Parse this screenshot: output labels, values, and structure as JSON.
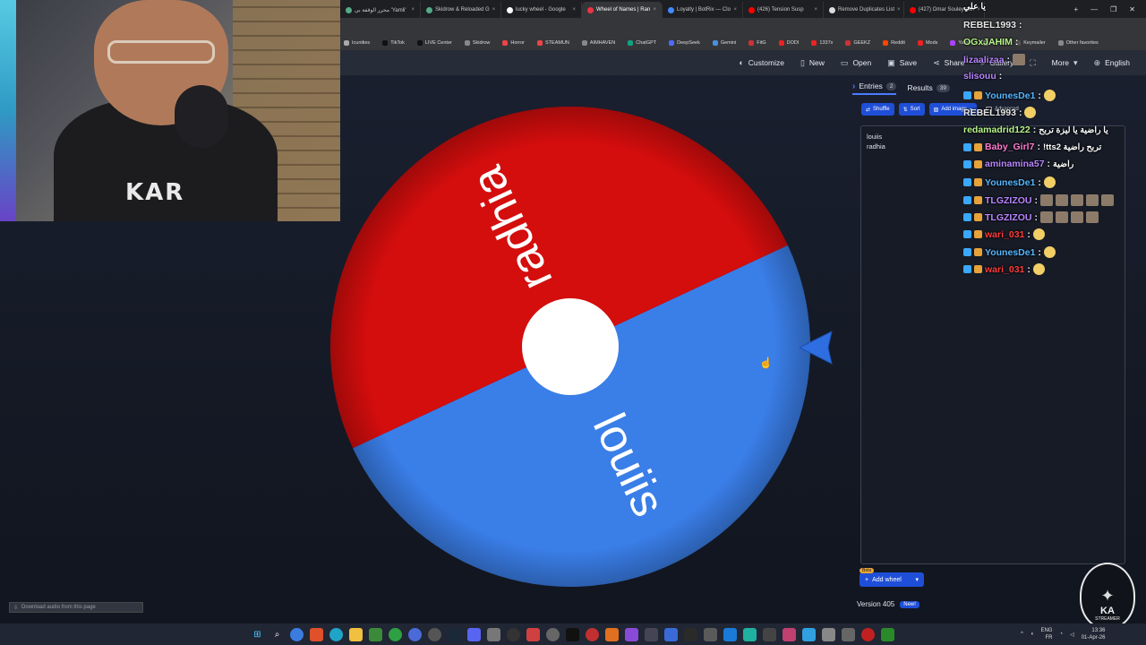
{
  "browser": {
    "tabs": [
      {
        "label": "محرر الوقفة بي 'Yamli'"
      },
      {
        "label": "Skidrow & Reloaded G"
      },
      {
        "label": "lucky wheel - Google"
      },
      {
        "label": "Wheel of Names | Ran"
      },
      {
        "label": "Loyalty | BotRix — Clo"
      },
      {
        "label": "(426) Tension Susp"
      },
      {
        "label": "Remove Duplicates List"
      },
      {
        "label": "(427) Omar Souleyman"
      }
    ],
    "bookmarks": [
      "Icunities",
      "TikTok",
      "LIVE Center",
      "Skidrow",
      "Horror",
      "STEAMUN",
      "AIMHAVEN",
      "ChatGPT",
      "DeepSeek",
      "Gemini",
      "FitG",
      "DODI",
      "1337x",
      "GEEKZ",
      "Reddit",
      "Mods",
      "Yamli",
      "Lurkit",
      "Keymailer",
      "Other favorites"
    ]
  },
  "toolbar": {
    "customize": "Customize",
    "new": "New",
    "open": "Open",
    "save": "Save",
    "share": "Share",
    "gallery": "Gallery",
    "more": "More",
    "language": "English"
  },
  "webcam": {
    "shirt_text": "KAR"
  },
  "chart_data": {
    "type": "pie",
    "categories": [
      "louiis",
      "radhia"
    ],
    "values": [
      50,
      50
    ],
    "colors": [
      "#3a7ee8",
      "#d40d0d"
    ],
    "rotation_deg": -25
  },
  "panel": {
    "tabs": {
      "entries": "Entries",
      "entries_count": "2",
      "results": "Results",
      "results_count": "39"
    },
    "buttons": {
      "shuffle": "Shuffle",
      "sort": "Sort",
      "add_image": "Add image",
      "advanced": "Advanced"
    },
    "entries": [
      "louiis",
      "radhia"
    ],
    "beta": "Beta",
    "add_wheel": "Add wheel",
    "version": "Version 405",
    "new_badge": "New!"
  },
  "chat": [
    {
      "user": "",
      "text": "يا علي",
      "user_color": "#ffffff"
    },
    {
      "user": "REBEL1993",
      "text": "",
      "user_color": "#e8e8e8"
    },
    {
      "user": "OGxJAHIM",
      "text": "",
      "user_color": "#b6f58a"
    },
    {
      "user": "lizaalizaa",
      "text": "",
      "user_color": "#b985ff"
    },
    {
      "user": "slisouu",
      "text": "",
      "user_color": "#b985ff"
    },
    {
      "user": "YounesDe1",
      "text": "",
      "user_color": "#56b7ff"
    },
    {
      "user": "REBEL1993",
      "text": "",
      "user_color": "#e8e8e8"
    },
    {
      "user": "redamadrid122",
      "text": "يا راضية يا ليزة تربح",
      "user_color": "#b6f58a"
    },
    {
      "user": "Baby_Girl7",
      "text": "!tts2 تربح راضية",
      "user_color": "#ff7bd0"
    },
    {
      "user": "aminamina57",
      "text": "راضية",
      "user_color": "#b985ff"
    },
    {
      "user": "YounesDe1",
      "text": "",
      "user_color": "#56b7ff"
    },
    {
      "user": "TLGZIZOU",
      "text": "",
      "user_color": "#b985ff"
    },
    {
      "user": "TLGZIZOU",
      "text": "",
      "user_color": "#b985ff"
    },
    {
      "user": "wari_031",
      "text": "",
      "user_color": "#ff3b3b"
    },
    {
      "user": "YounesDe1",
      "text": "",
      "user_color": "#56b7ff"
    },
    {
      "user": "wari_031",
      "text": "",
      "user_color": "#ff3b3b"
    }
  ],
  "download_bar": "Download audio from this page",
  "logo": {
    "letters": "KA",
    "sub": "STREAMER"
  },
  "taskbar": {
    "lang_top": "ENG",
    "lang_bottom": "FR",
    "time": "13:36",
    "date": "01-Apr-26"
  }
}
